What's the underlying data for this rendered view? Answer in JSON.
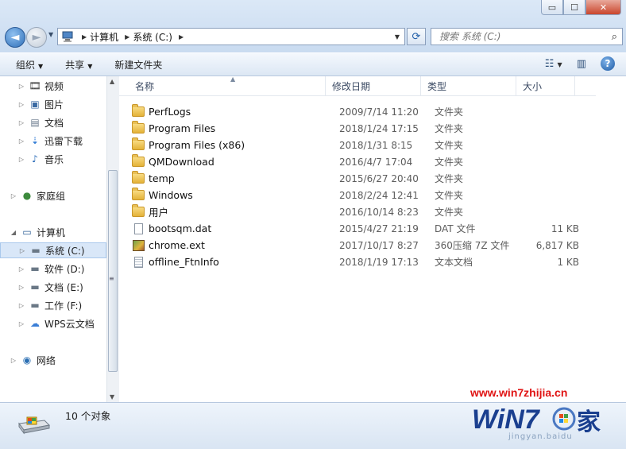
{
  "window": {
    "buttons": {
      "minimize": "▭",
      "maximize": "☐",
      "close": "✕"
    }
  },
  "address_bar": {
    "path": [
      "计算机",
      "系统 (C:)"
    ],
    "search_placeholder": "搜索 系统 (C:)"
  },
  "toolbar": {
    "organize": "组织",
    "share": "共享",
    "new_folder": "新建文件夹"
  },
  "nav": {
    "items": [
      {
        "label": "视频",
        "icon": "video-icon"
      },
      {
        "label": "图片",
        "icon": "pictures-icon"
      },
      {
        "label": "文档",
        "icon": "documents-icon"
      },
      {
        "label": "迅雷下载",
        "icon": "download-icon"
      },
      {
        "label": "音乐",
        "icon": "music-icon"
      },
      {
        "label": "家庭组",
        "icon": "homegroup-icon"
      },
      {
        "label": "计算机",
        "icon": "computer-icon"
      },
      {
        "label": "系统 (C:)",
        "icon": "system-drive-icon",
        "selected": true
      },
      {
        "label": "软件 (D:)",
        "icon": "drive-icon"
      },
      {
        "label": "文档 (E:)",
        "icon": "drive-icon"
      },
      {
        "label": "工作 (F:)",
        "icon": "drive-icon"
      },
      {
        "label": "WPS云文档",
        "icon": "cloud-icon"
      },
      {
        "label": "网络",
        "icon": "network-icon"
      }
    ]
  },
  "columns": [
    "名称",
    "修改日期",
    "类型",
    "大小"
  ],
  "files": [
    {
      "name": "PerfLogs",
      "date": "2009/7/14 11:20",
      "type": "文件夹",
      "size": "",
      "icon": "folder-icon"
    },
    {
      "name": "Program Files",
      "date": "2018/1/24 17:15",
      "type": "文件夹",
      "size": "",
      "icon": "folder-icon"
    },
    {
      "name": "Program Files (x86)",
      "date": "2018/1/31 8:15",
      "type": "文件夹",
      "size": "",
      "icon": "folder-icon"
    },
    {
      "name": "QMDownload",
      "date": "2016/4/7 17:04",
      "type": "文件夹",
      "size": "",
      "icon": "folder-icon"
    },
    {
      "name": "temp",
      "date": "2015/6/27 20:40",
      "type": "文件夹",
      "size": "",
      "icon": "folder-icon"
    },
    {
      "name": "Windows",
      "date": "2018/2/24 12:41",
      "type": "文件夹",
      "size": "",
      "icon": "folder-icon"
    },
    {
      "name": "用户",
      "date": "2016/10/14 8:23",
      "type": "文件夹",
      "size": "",
      "icon": "folder-icon"
    },
    {
      "name": "bootsqm.dat",
      "date": "2015/4/27 21:19",
      "type": "DAT 文件",
      "size": "11 KB",
      "icon": "file-icon"
    },
    {
      "name": "chrome.ext",
      "date": "2017/10/17 8:27",
      "type": "360压缩 7Z 文件",
      "size": "6,817 KB",
      "icon": "archive-icon"
    },
    {
      "name": "offline_FtnInfo",
      "date": "2018/1/19 17:13",
      "type": "文本文档",
      "size": "1 KB",
      "icon": "text-file-icon"
    }
  ],
  "status": {
    "count": "10 个对象"
  },
  "watermark": {
    "url": "www.win7zhijia.cn",
    "logo": "WiN7.家",
    "sub": "jingyan.baidu"
  },
  "colors": {
    "selection": "#d9e7f8",
    "chrome": "#dbe8f7",
    "watermark_red": "#e01414"
  }
}
